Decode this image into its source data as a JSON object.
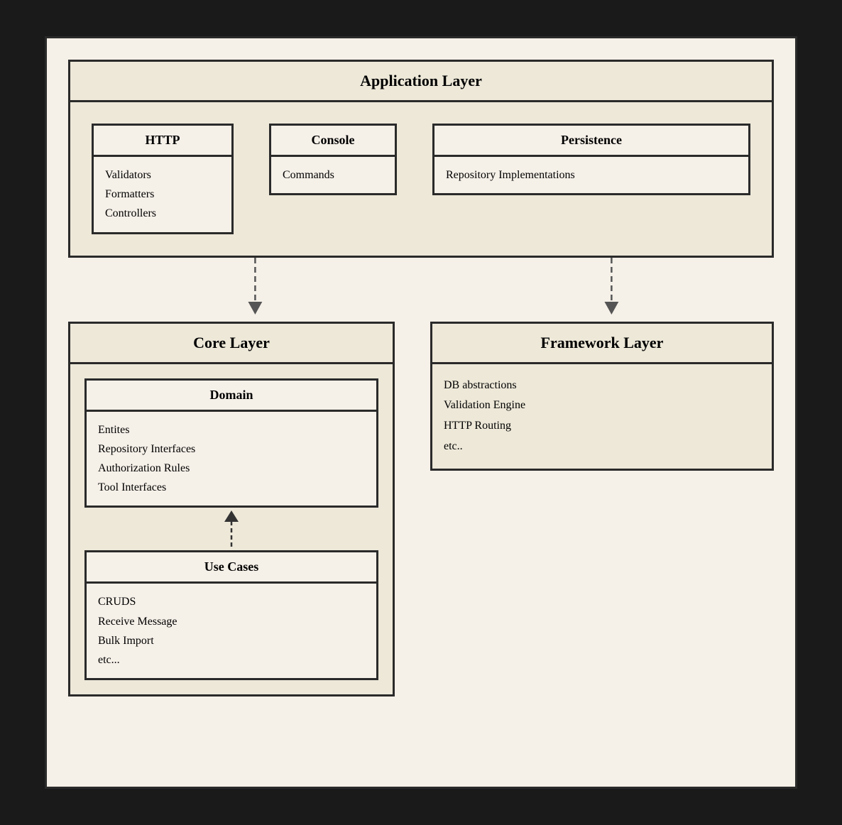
{
  "diagram": {
    "background_color": "#f5f0e8",
    "layers": {
      "application": {
        "title": "Application Layer",
        "components": {
          "http": {
            "title": "HTTP",
            "items": [
              "Validators",
              "Formatters",
              "Controllers"
            ]
          },
          "console": {
            "title": "Console",
            "items": [
              "Commands"
            ]
          },
          "persistence": {
            "title": "Persistence",
            "items": [
              "Repository Implementations"
            ]
          }
        }
      },
      "core": {
        "title": "Core Layer",
        "domain": {
          "title": "Domain",
          "items": [
            "Entites",
            "Repository Interfaces",
            "Authorization Rules",
            "Tool Interfaces"
          ]
        },
        "use_cases": {
          "title": "Use Cases",
          "items": [
            "CRUDS",
            "Receive Message",
            "Bulk Import",
            "etc..."
          ]
        }
      },
      "framework": {
        "title": "Framework Layer",
        "items": [
          "DB abstractions",
          "Validation Engine",
          "HTTP Routing",
          "etc.."
        ]
      }
    }
  }
}
